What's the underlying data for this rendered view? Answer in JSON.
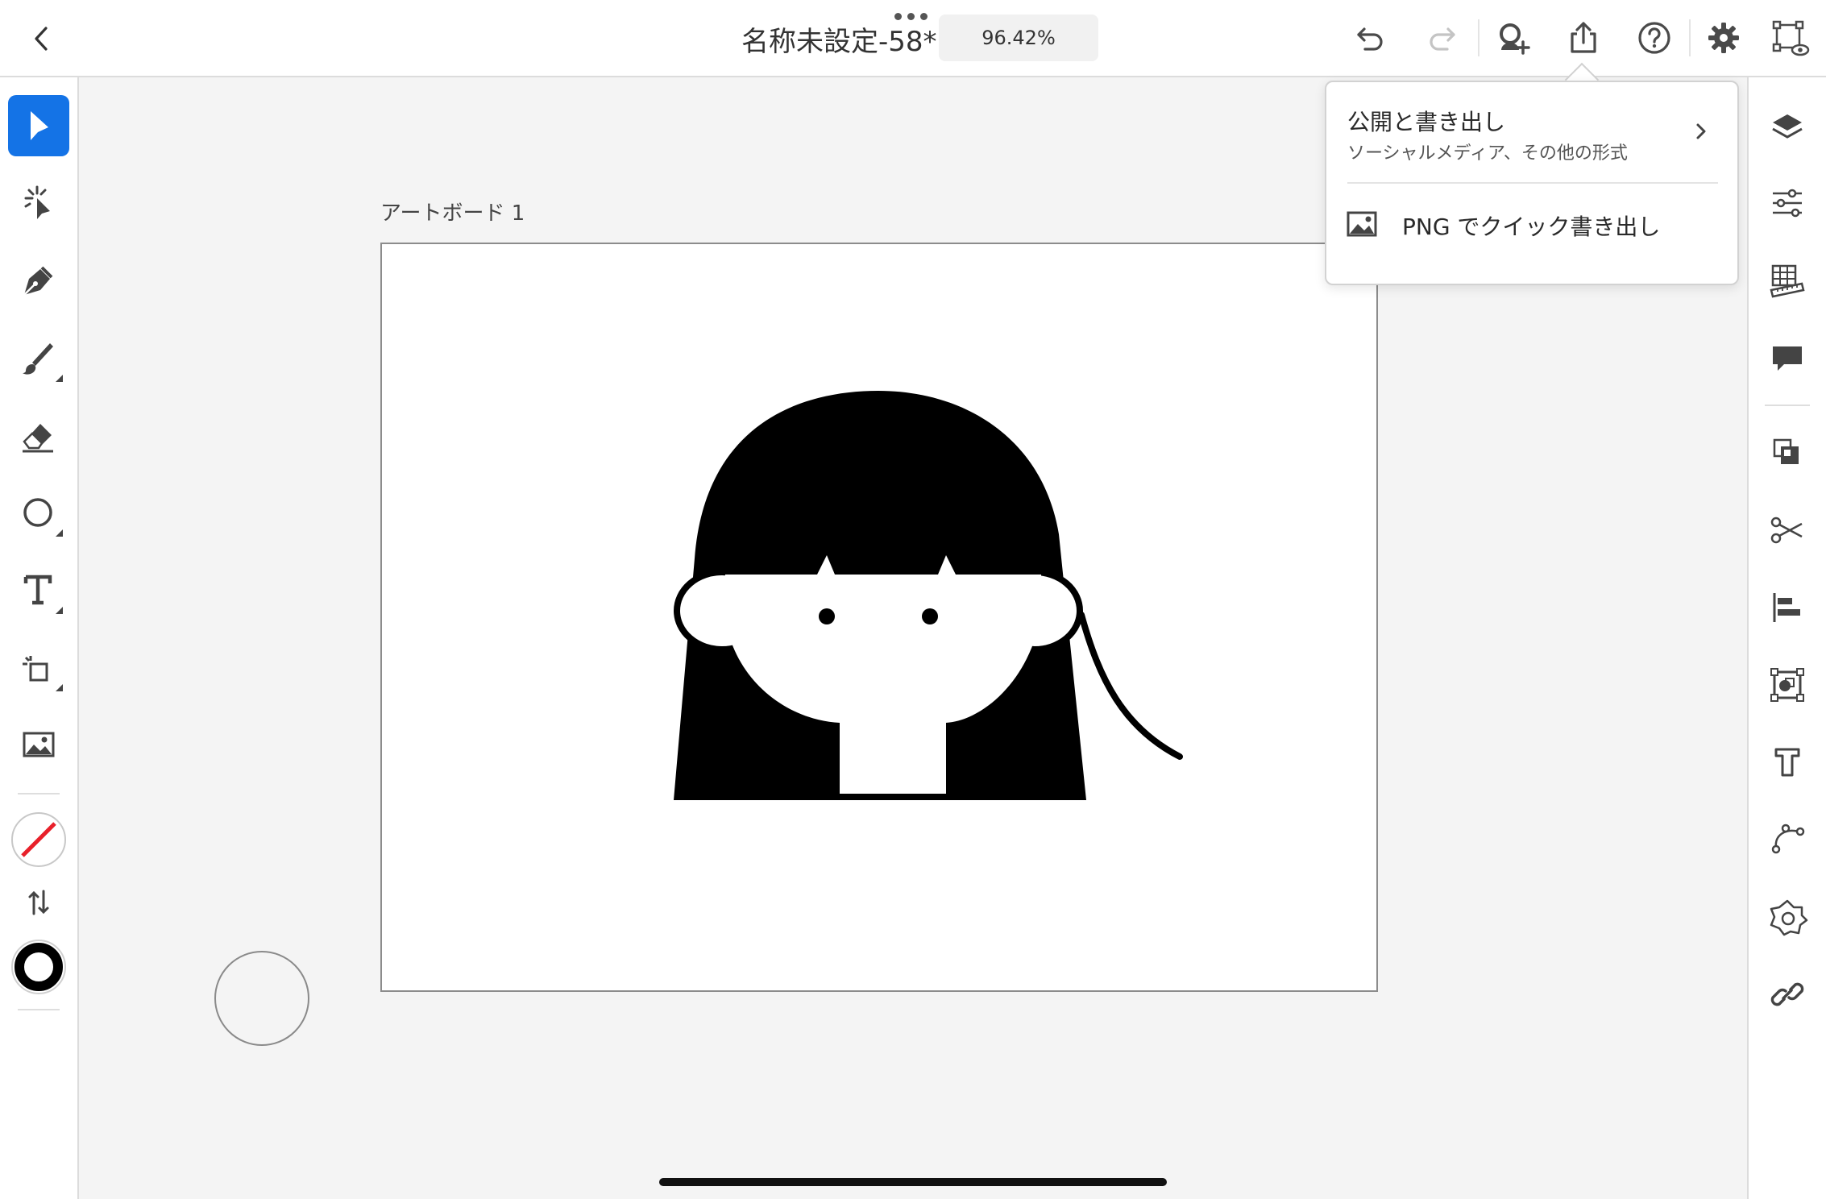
{
  "header": {
    "back_icon": "chevron-left-icon",
    "document_title": "名称未設定-58*",
    "zoom_level": "96.42%",
    "actions": [
      {
        "icon": "undo-icon"
      },
      {
        "icon": "redo-icon"
      },
      {
        "icon": "invite-user-icon"
      },
      {
        "icon": "share-export-icon"
      },
      {
        "icon": "help-icon"
      },
      {
        "icon": "gear-icon"
      },
      {
        "icon": "preview-icon"
      }
    ]
  },
  "tools": [
    {
      "icon": "select-arrow-icon",
      "selected": true
    },
    {
      "icon": "direct-select-icon"
    },
    {
      "icon": "pen-icon"
    },
    {
      "icon": "brush-icon"
    },
    {
      "icon": "eraser-icon"
    },
    {
      "icon": "ellipse-icon"
    },
    {
      "icon": "type-icon"
    },
    {
      "icon": "crop-icon"
    },
    {
      "icon": "image-icon"
    },
    {
      "icon": "fill-none-icon"
    },
    {
      "icon": "swap-fill-stroke-icon"
    },
    {
      "icon": "stroke-black-icon"
    }
  ],
  "colors": {
    "accent": "#1473e6",
    "fill_none_slash": "#e8202a",
    "stroke": "#000000"
  },
  "right_panel": [
    {
      "icon": "layers-icon"
    },
    {
      "icon": "properties-sliders-icon"
    },
    {
      "icon": "grid-ruler-icon"
    },
    {
      "icon": "comment-icon"
    },
    {
      "icon": "arrange-icon"
    },
    {
      "icon": "scissors-icon"
    },
    {
      "icon": "align-icon"
    },
    {
      "icon": "pathfinder-icon"
    },
    {
      "icon": "text-properties-icon"
    },
    {
      "icon": "path-icon"
    },
    {
      "icon": "repeat-grid-icon"
    },
    {
      "icon": "link-icon"
    }
  ],
  "canvas": {
    "artboard_label": "アートボード 1"
  },
  "export_menu": {
    "publish_title": "公開と書き出し",
    "publish_subtitle": "ソーシャルメディア、その他の形式",
    "quick_export_label": "PNG でクイック書き出し"
  }
}
